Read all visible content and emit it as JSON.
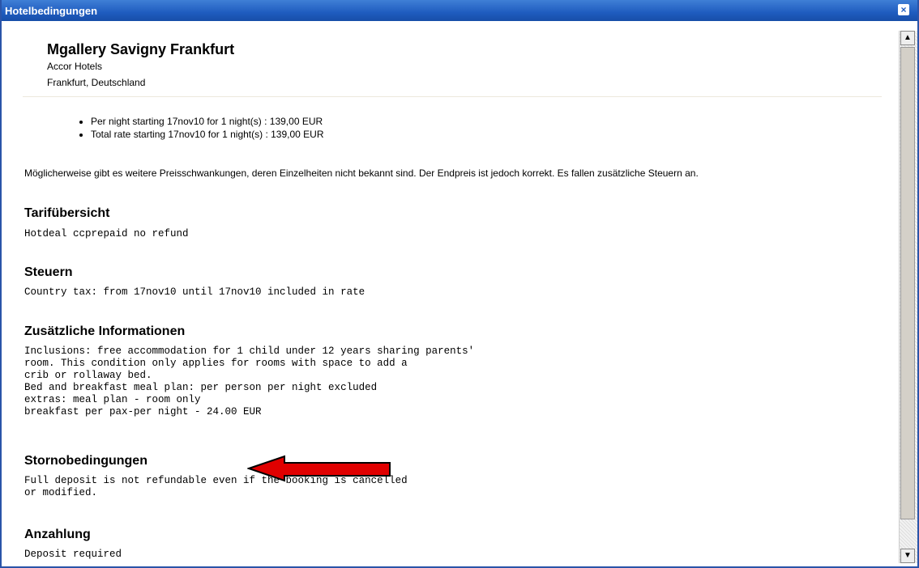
{
  "window": {
    "title": "Hotelbedingungen",
    "close_icon": "close-icon"
  },
  "hotel": {
    "name": "Mgallery Savigny Frankfurt",
    "chain": "Accor Hotels",
    "location": "Frankfurt, Deutschland"
  },
  "rates": [
    "Per night starting 17nov10 for 1 night(s) : 139,00 EUR",
    "Total rate starting 17nov10 for 1 night(s) : 139,00 EUR"
  ],
  "note": "Möglicherweise gibt es weitere Preisschwankungen, deren Einzelheiten nicht bekannt sind. Der Endpreis ist jedoch korrekt. Es fallen zusätzliche Steuern an.",
  "sections": {
    "tarif": {
      "heading": "Tarifübersicht",
      "body": "Hotdeal ccprepaid no refund"
    },
    "steuern": {
      "heading": "Steuern",
      "body": "Country tax: from 17nov10 until 17nov10 included in rate"
    },
    "zusatz": {
      "heading": "Zusätzliche Informationen",
      "body": "Inclusions: free accommodation for 1 child under 12 years sharing parents'\nroom. This condition only applies for rooms with space to add a\ncrib or rollaway bed.\nBed and breakfast meal plan: per person per night excluded\nextras: meal plan - room only\nbreakfast per pax-per night - 24.00 EUR"
    },
    "storno": {
      "heading": "Stornobedingungen",
      "body": "Full deposit is not refundable even if the booking is cancelled\nor modified."
    },
    "anzahlung": {
      "heading": "Anzahlung",
      "body": "Deposit required"
    }
  },
  "colors": {
    "titlebar": "#1f5cbf",
    "arrow": "#e00000"
  }
}
